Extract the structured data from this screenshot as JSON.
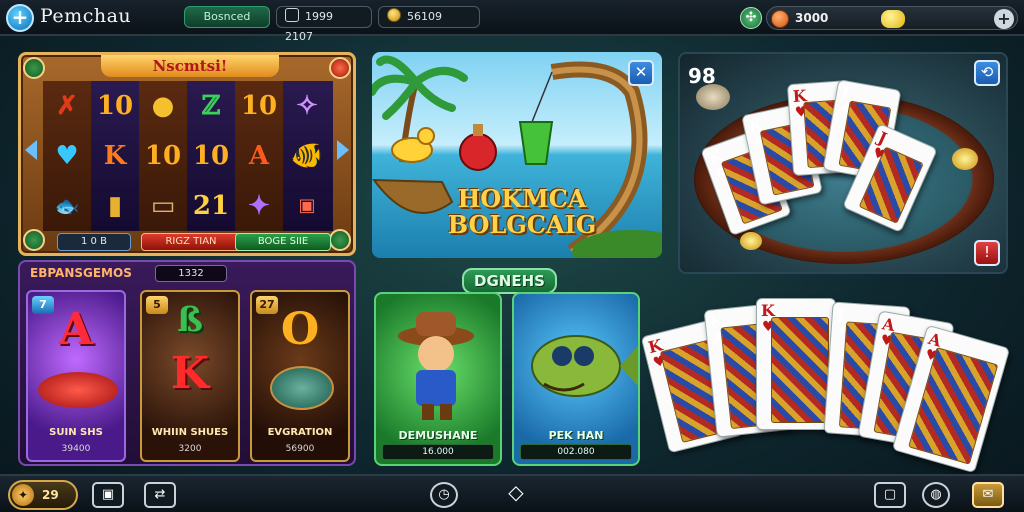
{
  "header": {
    "app_title": "Pemchau",
    "pill_green": "Bosnced",
    "pill_mid": "1999 2107",
    "pill_coins": "56109",
    "balance": "3000",
    "add_symbol": "+"
  },
  "slot_game": {
    "title": "Nscmtsi!",
    "reels": [
      [
        "✗",
        "♥",
        "🐟"
      ],
      [
        "10",
        "K",
        "▮"
      ],
      [
        "●",
        "10",
        "▭"
      ],
      [
        "ℤ",
        "10",
        "21"
      ],
      [
        "10",
        "A",
        "✦"
      ],
      [
        "✧",
        "🐠",
        "▣"
      ]
    ],
    "bottom_left_label": "1 0 B",
    "bottom_mid_label": "RIGZ TIAN",
    "bottom_right_label": "BOGE SIIE"
  },
  "fishing_banner": {
    "title_line1": "HOKMCA",
    "title_line2": "BOLGCAIG",
    "corner_symbol": "✕"
  },
  "card_table": {
    "player_count": "98",
    "corner_symbol": "⟲",
    "alert_symbol": "!",
    "cards": [
      {
        "rank": "K",
        "suit": "♣",
        "color": "#111111"
      },
      {
        "rank": "K",
        "suit": "♠",
        "color": "#111111"
      },
      {
        "rank": "K",
        "suit": "♥",
        "color": "#c01818"
      },
      {
        "rank": "J",
        "suit": "♠",
        "color": "#111111"
      },
      {
        "rank": "J",
        "suit": "♥",
        "color": "#c01818"
      }
    ]
  },
  "lower_left": {
    "title": "EBPANSGEMOS",
    "count": "1332",
    "games": [
      {
        "badge": "7",
        "letter": "A",
        "name": "SUIN SHS",
        "value": "39400"
      },
      {
        "badge": "5",
        "letter": "K",
        "name": "WHIIN SHUES",
        "value": "3200"
      },
      {
        "badge": "27",
        "letter": "O",
        "name": "EVGRATION",
        "value": "56900"
      }
    ]
  },
  "lower_mid": {
    "title": "DGNEHS",
    "characters": [
      {
        "name": "DEMUSHANE",
        "value": "16.000"
      },
      {
        "name": "PEK HAN",
        "value": "002.080"
      }
    ]
  },
  "lower_right": {
    "cards": [
      {
        "rank": "K",
        "suit": "♥",
        "color": "#c01818"
      },
      {
        "rank": "K",
        "suit": "♣",
        "color": "#111111"
      },
      {
        "rank": "K",
        "suit": "♥",
        "color": "#c01818"
      },
      {
        "rank": "J",
        "suit": "♠",
        "color": "#111111"
      },
      {
        "rank": "A",
        "suit": "♥",
        "color": "#c01818"
      },
      {
        "rank": "A",
        "suit": "♥",
        "color": "#c01818"
      }
    ]
  },
  "footer": {
    "level_top": "✦",
    "level": "29",
    "menu_glyph": "▣",
    "swap_glyph": "⇄",
    "clock_glyph": "◷",
    "nav_glyph": "◇",
    "chat_glyph": "▢",
    "globe_glyph": "◍",
    "mail_glyph": "✉"
  },
  "colors": {
    "accent_gold": "#ffd24a",
    "accent_green": "#2d9a55",
    "accent_purple": "#7a4ab0",
    "card_red": "#c01818"
  }
}
